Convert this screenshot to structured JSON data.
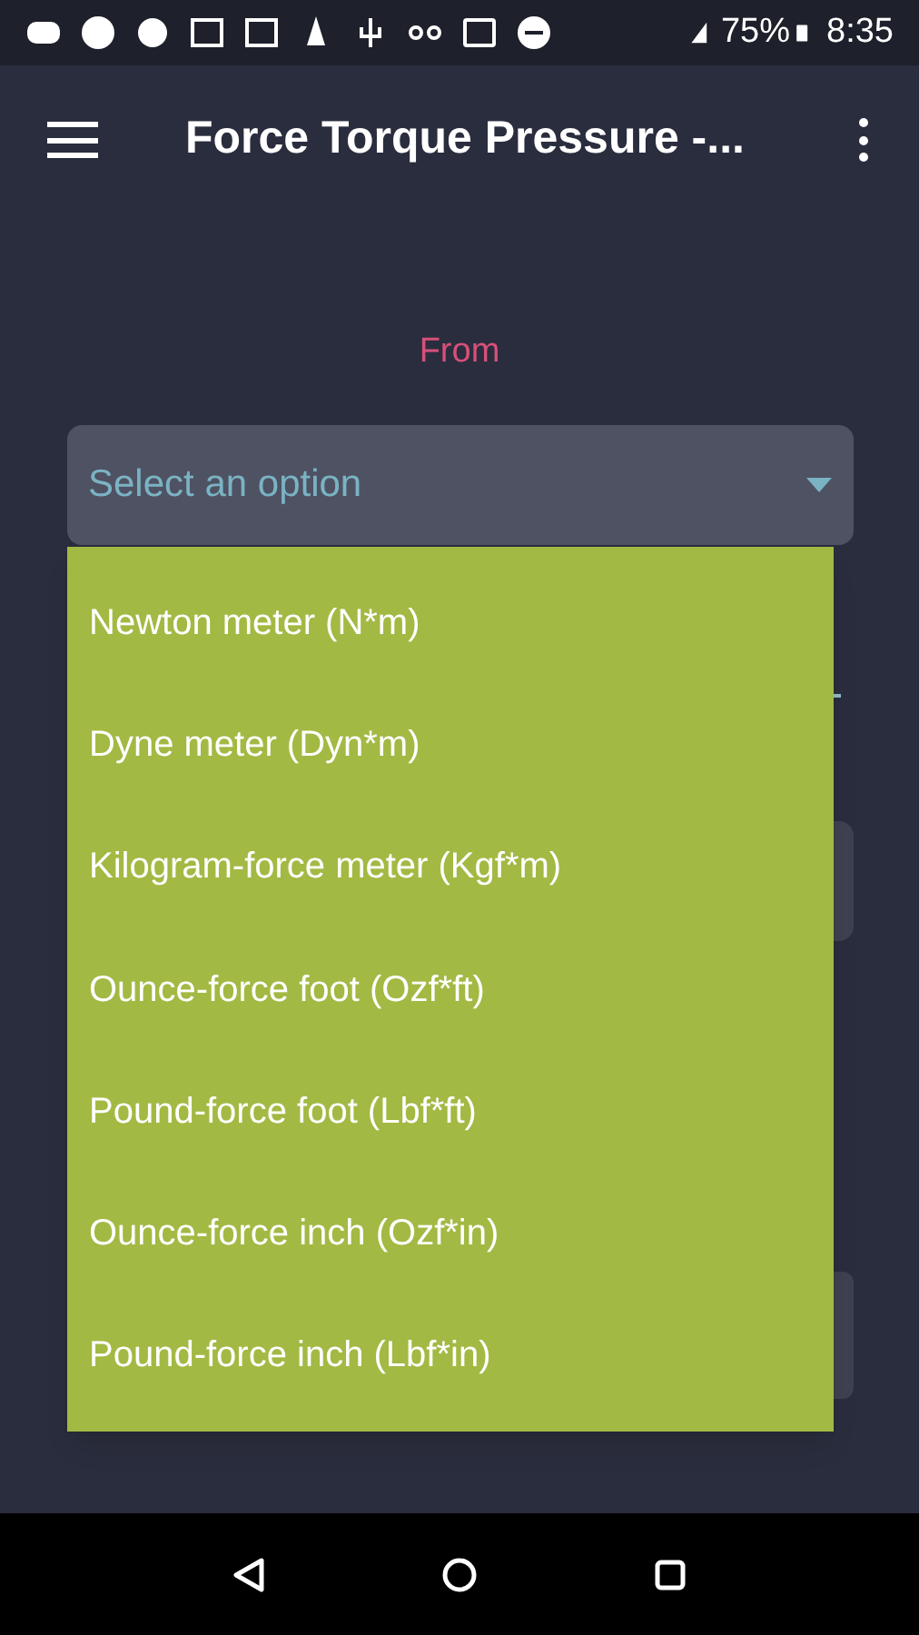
{
  "status_bar": {
    "battery": "75%",
    "time": "8:35"
  },
  "app_bar": {
    "title": "Force Torque Pressure -..."
  },
  "from_label": "From",
  "from_select": {
    "placeholder": "Select an option",
    "expanded": true
  },
  "options": [
    {
      "label": "Newton meter (N*m)"
    },
    {
      "label": "Dyne meter (Dyn*m)"
    },
    {
      "label": "Kilogram-force meter (Kgf*m)"
    },
    {
      "label": "Ounce-force foot (Ozf*ft)"
    },
    {
      "label": "Pound-force foot (Lbf*ft)"
    },
    {
      "label": "Ounce-force inch (Ozf*in)"
    },
    {
      "label": "Pound-force inch (Lbf*in)"
    }
  ]
}
